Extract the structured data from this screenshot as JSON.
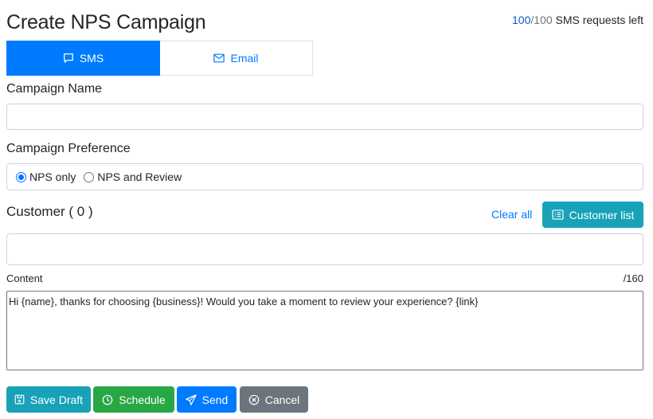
{
  "header": {
    "title": "Create NPS Campaign",
    "quota": {
      "used": "100",
      "separator": "/",
      "total": "100",
      "suffix": " SMS requests left"
    }
  },
  "tabs": [
    {
      "label": "SMS",
      "icon": "chat-icon",
      "active": true
    },
    {
      "label": "Email",
      "icon": "envelope-icon",
      "active": false
    }
  ],
  "campaign_name": {
    "label": "Campaign Name",
    "value": "",
    "placeholder": ""
  },
  "campaign_preference": {
    "label": "Campaign Preference",
    "options": [
      {
        "label": "NPS only",
        "checked": true
      },
      {
        "label": "NPS and Review",
        "checked": false
      }
    ]
  },
  "customer": {
    "label": "Customer ( 0 )",
    "clear_all": "Clear all",
    "customer_list_button": "Customer list",
    "value": ""
  },
  "content": {
    "label": "Content",
    "counter": "/160",
    "value": "Hi {name}, thanks for choosing {business}! Would you take a moment to review your experience? {link}"
  },
  "actions": {
    "save_draft": "Save Draft",
    "schedule": "Schedule",
    "send": "Send",
    "cancel": "Cancel"
  },
  "colors": {
    "primary": "#007bff",
    "info": "#17a2b8",
    "success": "#28a745",
    "secondary": "#6c757d"
  }
}
